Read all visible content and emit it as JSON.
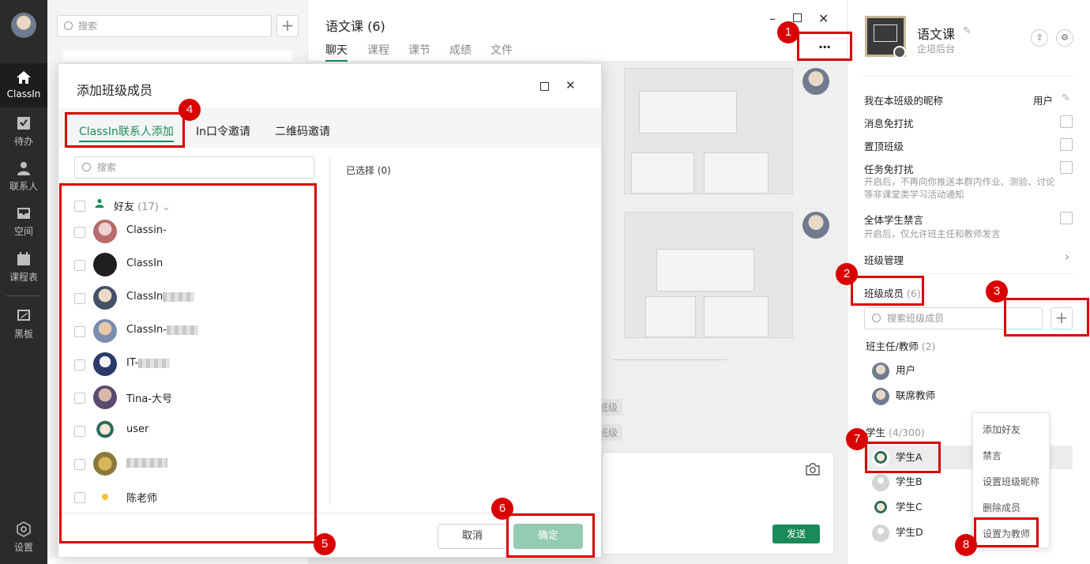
{
  "nav": {
    "items": [
      {
        "label": "ClassIn",
        "icon": "home-icon"
      },
      {
        "label": "待办",
        "icon": "todo-icon"
      },
      {
        "label": "联系人",
        "icon": "contacts-icon"
      },
      {
        "label": "空间",
        "icon": "space-icon"
      },
      {
        "label": "课程表",
        "icon": "calendar-icon"
      },
      {
        "label": "黑板",
        "icon": "blackboard-icon"
      },
      {
        "label": "设置",
        "icon": "settings-icon"
      }
    ]
  },
  "conv": {
    "search_placeholder": "搜索"
  },
  "chat": {
    "title": "语文课 (6)",
    "tabs": [
      "聊天",
      "课程",
      "课节",
      "成绩",
      "文件"
    ],
    "pill1": "班级",
    "pill2": "班级",
    "send": "发送",
    "more": "···"
  },
  "right": {
    "class_name": "语文课",
    "class_sub": "企培后台",
    "nickname_label": "我在本班级的昵称",
    "nickname_value": "用户",
    "mute_label": "消息免打扰",
    "pin_label": "置顶班级",
    "task_label": "任务免打扰",
    "task_desc": "开启后，不再向你推送本群内作业、测验、讨论等非课堂类学习活动通知",
    "ban_label": "全体学生禁言",
    "ban_desc": "开启后，仅允许班主任和教师发言",
    "manage_label": "班级管理",
    "members_label": "班级成员",
    "members_count": "(6)",
    "member_search_placeholder": "搜索班级成员",
    "teachers_label": "班主任/教师",
    "teachers_count": "(2)",
    "teachers": [
      "用户",
      "联席教师"
    ],
    "students_label": "学生",
    "students_count": "(4/300)",
    "students": [
      "学生A",
      "学生B",
      "学生C",
      "学生D"
    ]
  },
  "context_menu": [
    "添加好友",
    "禁言",
    "设置班级昵称",
    "删除成员",
    "设置为教师"
  ],
  "modal": {
    "title": "添加班级成员",
    "tabs": [
      "ClassIn联系人添加",
      "In口令邀请",
      "二维码邀请"
    ],
    "search_placeholder": "搜索",
    "group_label": "好友",
    "group_count": "(17)",
    "selected_label": "已选择 (0)",
    "contacts": [
      "Classin-",
      "ClassIn",
      "ClassIn",
      "ClassIn-",
      "IT-",
      "Tina-大号",
      "user",
      "",
      "陈老师"
    ],
    "cancel": "取消",
    "confirm": "确定"
  },
  "annotations": [
    "1",
    "2",
    "3",
    "4",
    "5",
    "6",
    "7",
    "8"
  ]
}
